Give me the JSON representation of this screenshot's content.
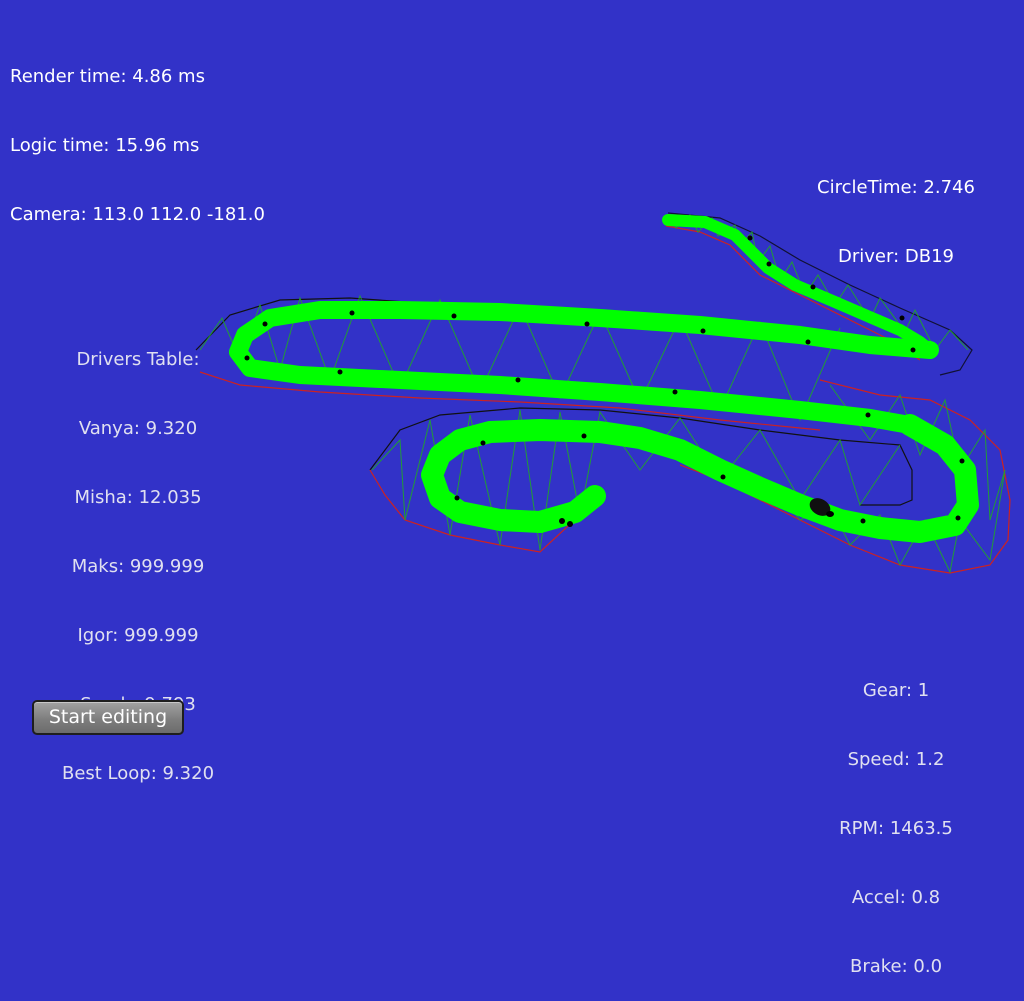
{
  "debug": {
    "render_time": "Render time: 4.86 ms",
    "logic_time": "Logic time: 15.96 ms",
    "camera": "Camera: 113.0 112.0 -181.0"
  },
  "lap": {
    "circle_time": "CircleTime: 2.746",
    "driver": "Driver: DB19"
  },
  "drivers_table": {
    "title": "Drivers Table:",
    "entries": [
      "Vanya: 9.320",
      "Misha: 12.035",
      "Maks: 999.999",
      "Igor: 999.999",
      "Snedr: 9.793"
    ],
    "best_loop": "Best Loop: 9.320"
  },
  "car": {
    "gear": "Gear: 1",
    "speed": "Speed: 1.2",
    "rpm": "RPM: 1463.5",
    "accel": "Accel: 0.8",
    "brake": "Brake: 0.0"
  },
  "controls": {
    "start_editing_label": "Start editing"
  },
  "colors": {
    "background": "#3232c8",
    "track_fill": "#00ff00",
    "track_mesh": "#1aa01a",
    "edge_outer": "#000000",
    "edge_inner": "#cc1111",
    "markers": "#000000"
  }
}
